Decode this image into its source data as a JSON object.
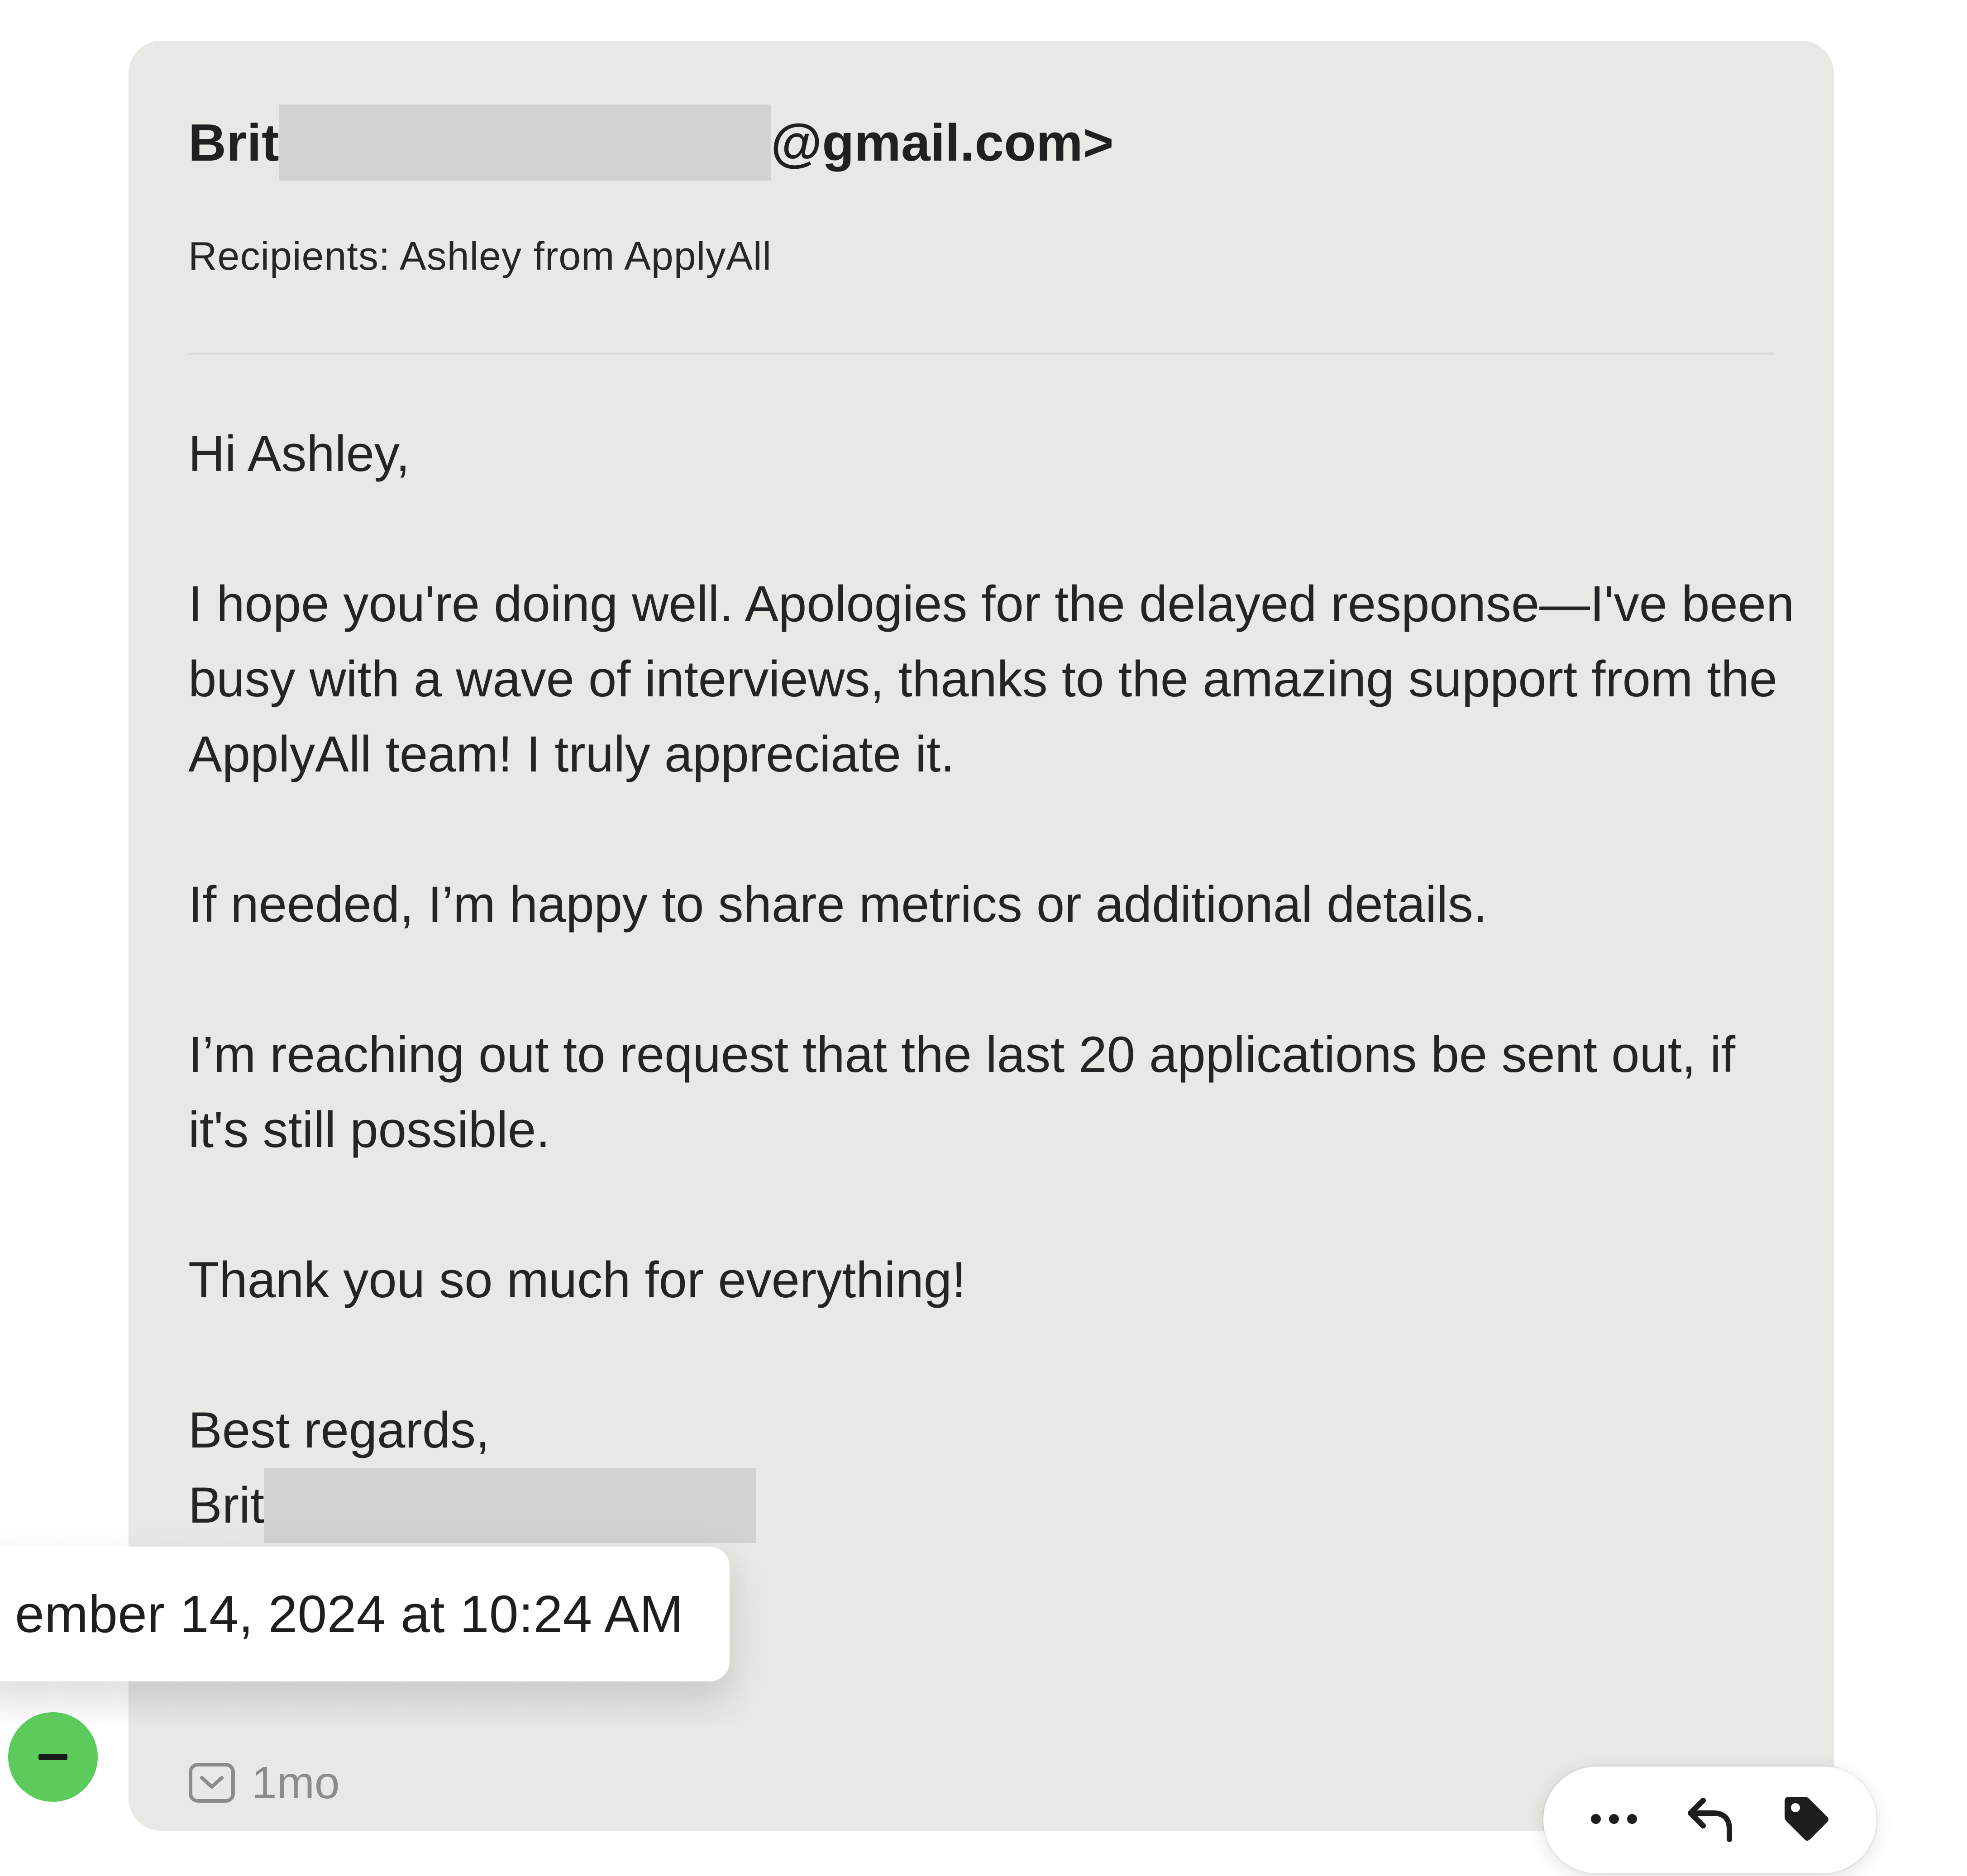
{
  "email": {
    "sender_prefix": "Brit",
    "sender_suffix": "@gmail.com>",
    "recipients": "Recipients: Ashley from ApplyAll",
    "body": {
      "greeting": "Hi Ashley,",
      "paragraph_1": "I hope you're doing well. Apologies for the delayed response—I've been busy with a wave of interviews, thanks to the amazing support from the ApplyAll team! I truly appreciate it.",
      "paragraph_2": "If needed, I’m happy to share metrics or additional details.",
      "paragraph_3": "I’m reaching out to request that the last 20 applications be sent out, if it's still possible.",
      "paragraph_4": "Thank you so much for everything!",
      "sign_off": "Best regards,",
      "signature_prefix": "Brit",
      "trailing_mark": "."
    },
    "meta": {
      "icon": "mail-icon",
      "relative_time": "1mo"
    }
  },
  "tooltip": {
    "text": "ember 14, 2024 at 10:24 AM"
  },
  "collapse_button": {
    "icon": "minus-icon",
    "color": "#5bcc5c"
  },
  "toolbar": {
    "icons": [
      "more-icon",
      "reply-icon",
      "tag-icon"
    ]
  },
  "colors": {
    "card_background": "#e8e8e5",
    "redaction": "#d2d2d1",
    "meta_text": "#8c8c8a"
  }
}
